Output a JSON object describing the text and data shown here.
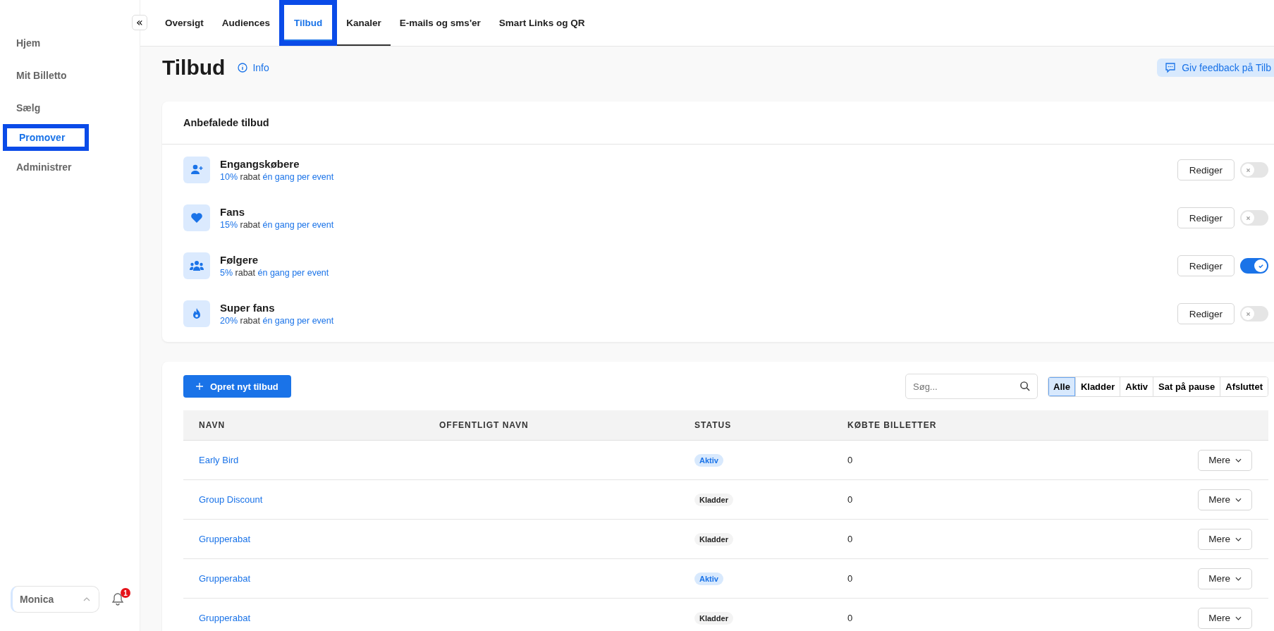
{
  "sidebar": {
    "items": [
      {
        "label": "Hjem",
        "selected": false,
        "highlighted": false
      },
      {
        "label": "Mit Billetto",
        "selected": false,
        "highlighted": false
      },
      {
        "label": "Sælg",
        "selected": false,
        "highlighted": false
      },
      {
        "label": "Promover",
        "selected": true,
        "highlighted": true
      },
      {
        "label": "Administrer",
        "selected": false,
        "highlighted": false
      }
    ],
    "collapse_button": "«",
    "user": {
      "name": "Monica"
    },
    "notifications": {
      "count": "1"
    }
  },
  "tabs": [
    {
      "label": "Oversigt",
      "selected": false,
      "hover": false,
      "highlighted": false
    },
    {
      "label": "Audiences",
      "selected": false,
      "hover": false,
      "highlighted": false
    },
    {
      "label": "Tilbud",
      "selected": true,
      "hover": false,
      "highlighted": true
    },
    {
      "label": "Kanaler",
      "selected": false,
      "hover": true,
      "highlighted": false
    },
    {
      "label": "E-mails og sms'er",
      "selected": false,
      "hover": false,
      "highlighted": false
    },
    {
      "label": "Smart Links og QR",
      "selected": false,
      "hover": false,
      "highlighted": false
    }
  ],
  "page": {
    "title": "Tilbud",
    "info_link": "Info",
    "feedback_button": "Giv feedback på Tilb"
  },
  "recommended": {
    "title": "Anbefalede tilbud",
    "offers": [
      {
        "kind": "buyer",
        "name": "Engangskøbere",
        "discount": "10%",
        "rabat": "rabat",
        "frequency": "én gang per event",
        "edit": "Rediger",
        "on": false
      },
      {
        "kind": "heart",
        "name": "Fans",
        "discount": "15%",
        "rabat": "rabat",
        "frequency": "én gang per event",
        "edit": "Rediger",
        "on": false
      },
      {
        "kind": "group",
        "name": "Følgere",
        "discount": "5%",
        "rabat": "rabat",
        "frequency": "én gang per event",
        "edit": "Rediger",
        "on": true
      },
      {
        "kind": "fire",
        "name": "Super fans",
        "discount": "20%",
        "rabat": "rabat",
        "frequency": "én gang per event",
        "edit": "Rediger",
        "on": false
      }
    ]
  },
  "offers": {
    "create_button": "Opret nyt tilbud",
    "search": {
      "placeholder": "Søg..."
    },
    "filters": [
      {
        "label": "Alle",
        "selected": true
      },
      {
        "label": "Kladder",
        "selected": false
      },
      {
        "label": "Aktiv",
        "selected": false
      },
      {
        "label": "Sat på pause",
        "selected": false
      },
      {
        "label": "Afsluttet",
        "selected": false
      }
    ],
    "table": {
      "columns": [
        "NAVN",
        "OFFENTLIGT NAVN",
        "STATUS",
        "KØBTE BILLETTER"
      ],
      "rows": [
        {
          "name": "Early Bird",
          "status": "Aktiv",
          "kind": "active",
          "tickets": "0",
          "action": "Mere"
        },
        {
          "name": "Group Discount",
          "status": "Kladder",
          "kind": "draft",
          "tickets": "0",
          "action": "Mere"
        },
        {
          "name": "Grupperabat",
          "status": "Kladder",
          "kind": "draft",
          "tickets": "0",
          "action": "Mere"
        },
        {
          "name": "Grupperabat",
          "status": "Aktiv",
          "kind": "active",
          "tickets": "0",
          "action": "Mere"
        },
        {
          "name": "Grupperabat",
          "status": "Kladder",
          "kind": "draft",
          "tickets": "0",
          "action": "Mere"
        }
      ]
    }
  }
}
